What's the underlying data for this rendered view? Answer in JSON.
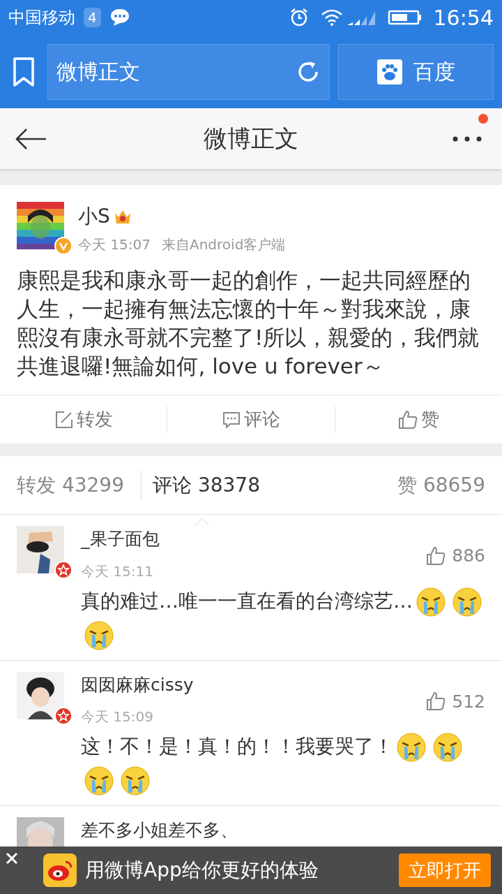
{
  "status_bar": {
    "carrier": "中国移动",
    "notification_count": "4",
    "time": "16:54"
  },
  "browser_bar": {
    "address": "微博正文",
    "search_engine": "百度"
  },
  "title_bar": {
    "title": "微博正文",
    "has_notification": true
  },
  "post": {
    "author": "小S",
    "verified": true,
    "time": "今天 15:07",
    "source": "来自Android客户端",
    "text": "康熙是我和康永哥一起的創作，一起共同經歷的人生，一起擁有無法忘懷的十年～對我來說，康熙沒有康永哥就不完整了!所以，親愛的，我們就共進退囉!無論如何, love u forever～"
  },
  "actions": [
    {
      "kind": "repost",
      "label": "转发"
    },
    {
      "kind": "comment",
      "label": "评论"
    },
    {
      "kind": "like",
      "label": "赞"
    }
  ],
  "stats_tabs": [
    {
      "label": "转发",
      "count": "43299",
      "selected": false
    },
    {
      "label": "评论",
      "count": "38378",
      "selected": true
    },
    {
      "label": "赞",
      "count": "68659",
      "selected": false
    }
  ],
  "comments": [
    {
      "name": "_果子面包",
      "vip": true,
      "time": "今天 15:11",
      "likes": "886",
      "text": "真的难过…唯一一直在看的台湾综艺…",
      "emojis": [
        {
          "kind": "crying"
        },
        {
          "kind": "crying"
        },
        {
          "kind": "crying"
        }
      ]
    },
    {
      "name": "囡囡麻麻cissy",
      "vip": true,
      "time": "今天 15:09",
      "likes": "512",
      "text": "这！不！是！真！的！！我要哭了！",
      "emojis": [
        {
          "kind": "crying"
        },
        {
          "kind": "crying"
        },
        {
          "kind": "crying"
        },
        {
          "kind": "crying"
        }
      ]
    },
    {
      "name": "差不多小姐差不多、"
    }
  ],
  "app_banner": {
    "text": "用微博App给你更好的体验",
    "button": "立即打开"
  }
}
